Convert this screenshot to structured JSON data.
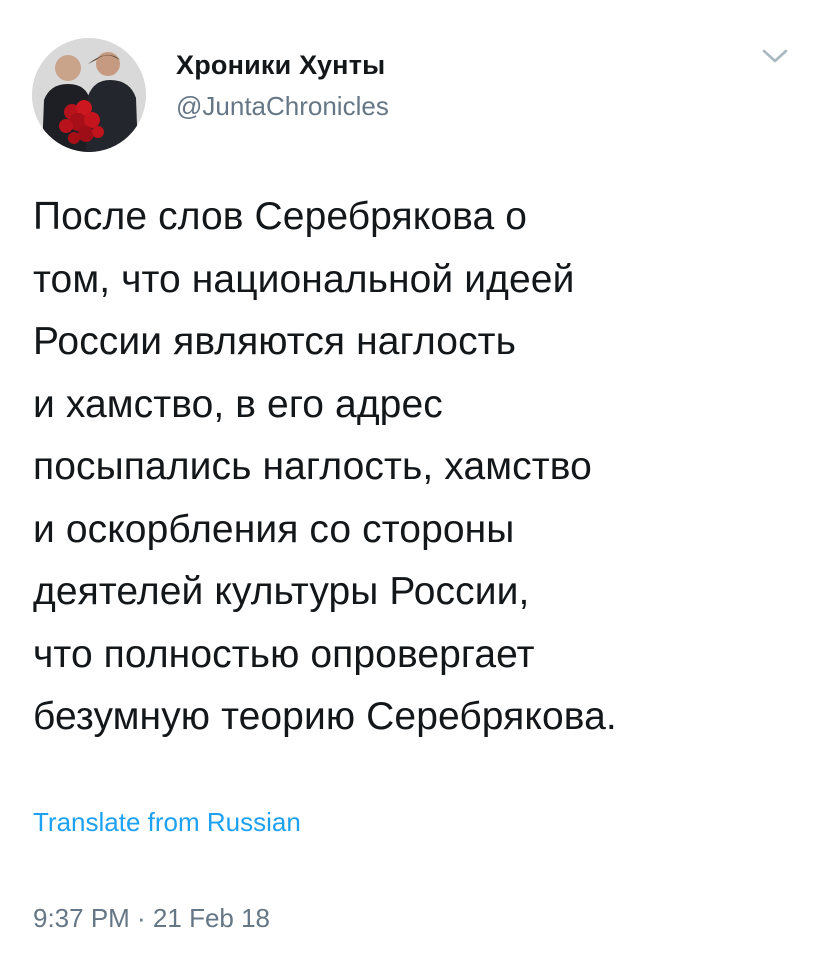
{
  "author": {
    "display_name": "Хроники Хунты",
    "handle": "@JuntaChronicles",
    "avatar_icon": "profile-photo"
  },
  "menu": {
    "icon": "chevron-down-icon"
  },
  "tweet": {
    "text": "После слов Серебрякова о\nтом, что национальной идеей\nРоссии являются наглость\nи хамство, в его адрес\nпосыпались наглость, хамство\nи оскорбления со стороны\nдеятелей культуры России,\nчто полностью опровергает\nбезумную теорию Серебрякова.",
    "translate_label": "Translate from Russian",
    "timestamp": "9:37 PM · 21 Feb 18"
  },
  "colors": {
    "link": "#1da1f2",
    "secondary_text": "#657786",
    "primary_text": "#14171a"
  }
}
